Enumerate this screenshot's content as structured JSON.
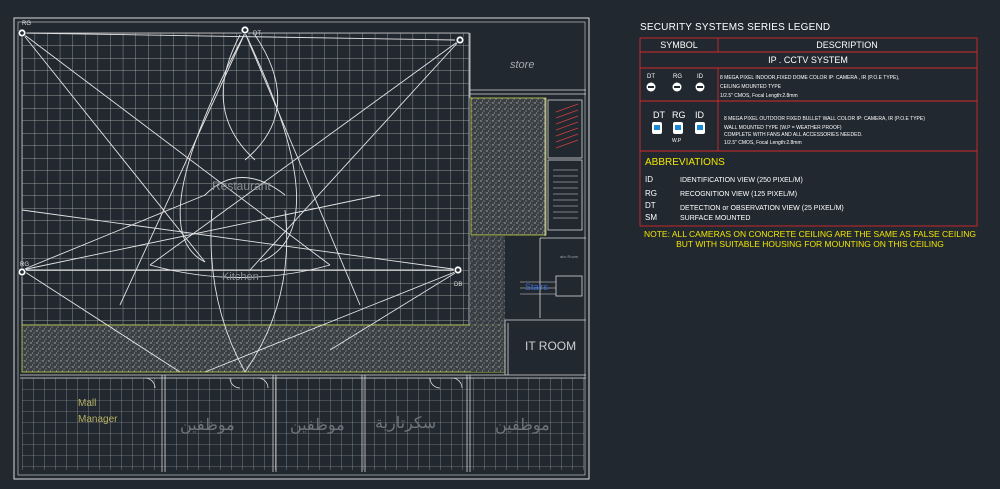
{
  "plan": {
    "rooms": {
      "store": "store",
      "restaurant": "Restaurant",
      "kitchen": "Kitchen",
      "it_room": "IT ROOM",
      "mall_manager_1": "Mall",
      "mall_manager_2": "Manager",
      "office_1": "موظفين",
      "office_2": "موظفين",
      "office_3": "سكرتارية",
      "office_4": "موظفين",
      "stairs": "Stairs",
      "small_label": "abc Room"
    },
    "camera_tags": {
      "top_left": "RG",
      "top_mid": "DT",
      "mid_left": "RG",
      "mid_right": "DB"
    }
  },
  "legend": {
    "title": "SECURITY SYSTEMS SERIES LEGEND",
    "col_symbol": "SYMBOL",
    "col_description": "DESCRIPTION",
    "section": "IP . CCTV SYSTEM",
    "row1": {
      "tags": [
        "DT",
        "RG",
        "ID"
      ],
      "line1": "8 MEGA PIXEL INDOOR,FIXED DOME COLOR IP: CAMERA , IR (P.O.E TYPE),",
      "line2": "CEILING MOUNTED TYPE",
      "line3": "1/2.5\" CMOS, Focal Length:2.8mm"
    },
    "row2": {
      "tags": [
        "DT",
        "RG",
        "ID"
      ],
      "wp": "W.P",
      "line1": "8 MEGA PIXEL OUTDOOR FIXED BULLET WALL COLOR IP: CAMERA, IR (P.O.E TYPE)",
      "line2": "WALL MOUNTED TYPE (W.P = WEATHER PROOF)",
      "line3": "COMPLETE WITH FANS AND ALL ACCESSORIES NEEDED.",
      "line4": "1/2.5\" CMOS, Focal Length:2.8mm"
    },
    "abbreviations_title": "ABBREVIATIONS",
    "abbreviations": [
      {
        "code": "ID",
        "text": "IDENTIFICATION VIEW (250 PIXEL/M)"
      },
      {
        "code": "RG",
        "text": "RECOGNITION VIEW (125 PIXEL/M)"
      },
      {
        "code": "DT",
        "text": "DETECTION or OBSERVATION VIEW (25 PIXEL/M)"
      },
      {
        "code": "SM",
        "text": "SURFACE MOUNTED"
      }
    ],
    "note_line1": "NOTE: ALL CAMERAS ON CONCRETE CEILING ARE THE SAME AS FALSE CEILING",
    "note_line2": "BUT WITH SUITABLE HOUSING FOR MOUNTING ON THIS CEILING"
  },
  "colors": {
    "background": "#212830",
    "wall": "#d9d9d9",
    "grid": "#d6d6cc",
    "hatch_border": "#c8d44a",
    "legend_border": "#d42a2a",
    "note": "#f2e600",
    "room_label": "#8a8f96",
    "manager_label": "#b8b060"
  }
}
